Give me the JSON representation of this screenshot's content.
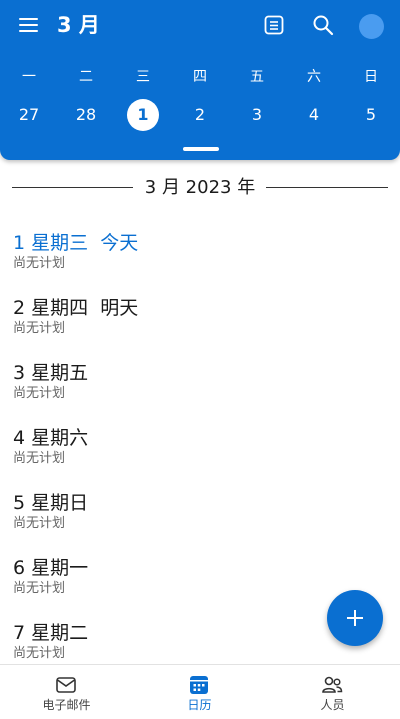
{
  "header": {
    "title": "3 月",
    "icons": {
      "menu": "hamburger-menu-icon",
      "agenda": "agenda-view-icon",
      "search": "search-icon",
      "avatar": "account-avatar"
    },
    "accent_color": "#0a6fd1"
  },
  "week_strip": {
    "weekdays": [
      "一",
      "二",
      "三",
      "四",
      "五",
      "六",
      "日"
    ],
    "dates": [
      "27",
      "28",
      "1",
      "2",
      "3",
      "4",
      "5"
    ],
    "selected_index": 2
  },
  "agenda": {
    "month_heading": "3 月 2023 年",
    "days": [
      {
        "title": "1 星期三  今天",
        "subtitle": "尚无计划",
        "is_today": true
      },
      {
        "title": "2 星期四  明天",
        "subtitle": "尚无计划",
        "is_today": false
      },
      {
        "title": "3 星期五",
        "subtitle": "尚无计划",
        "is_today": false
      },
      {
        "title": "4 星期六",
        "subtitle": "尚无计划",
        "is_today": false
      },
      {
        "title": "5 星期日",
        "subtitle": "尚无计划",
        "is_today": false
      },
      {
        "title": "6 星期一",
        "subtitle": "尚无计划",
        "is_today": false
      },
      {
        "title": "7 星期二",
        "subtitle": "尚无计划",
        "is_today": false
      }
    ]
  },
  "fab": {
    "icon": "plus-icon"
  },
  "bottom_nav": {
    "items": [
      {
        "label": "电子邮件",
        "icon": "mail-icon",
        "active": false
      },
      {
        "label": "日历",
        "icon": "calendar-icon",
        "active": true
      },
      {
        "label": "人员",
        "icon": "people-icon",
        "active": false
      }
    ]
  }
}
